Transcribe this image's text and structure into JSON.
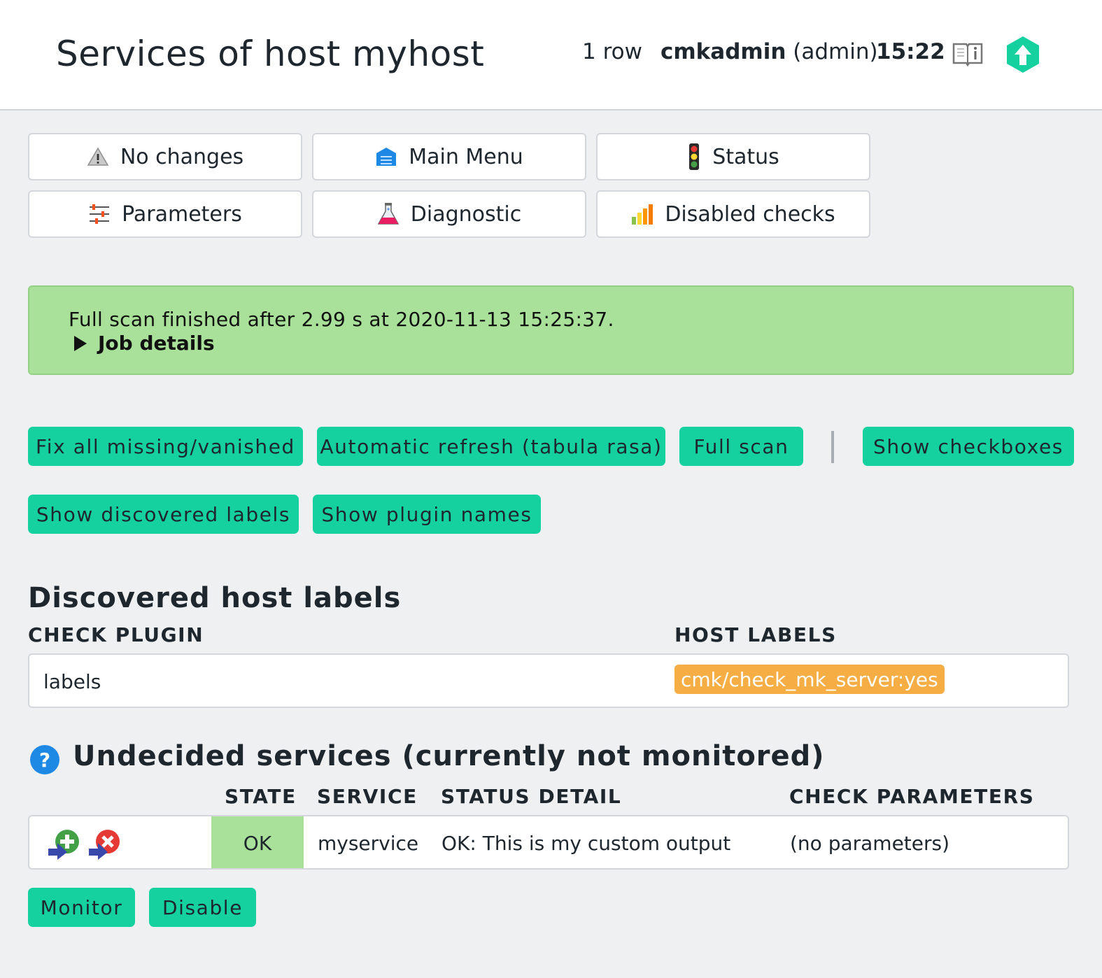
{
  "header": {
    "title": "Services of host myhost",
    "row_count": "1 row",
    "user_name": "cmkadmin",
    "user_role": "(admin)",
    "time": "15:22",
    "help_icon": "book-icon",
    "logo_icon": "checkmk-logo-icon"
  },
  "page_menu": [
    {
      "label": "No changes",
      "icon": "warning-icon"
    },
    {
      "label": "Main Menu",
      "icon": "main-menu-icon"
    },
    {
      "label": "Status",
      "icon": "traffic-light-icon"
    },
    {
      "label": "Parameters",
      "icon": "parameters-icon"
    },
    {
      "label": "Diagnostic",
      "icon": "flask-icon"
    },
    {
      "label": "Disabled checks",
      "icon": "bar-chart-icon"
    }
  ],
  "message": {
    "text": "Full scan finished after 2.99 s at 2020-11-13 15:25:37.",
    "job_details": "Job details",
    "background_color": "#a9e19a"
  },
  "actions": {
    "fix_all": "Fix all missing/vanished",
    "auto_refresh": "Automatic refresh (tabula rasa)",
    "full_scan": "Full scan",
    "show_checkboxes": "Show checkboxes",
    "show_labels": "Show discovered labels",
    "show_plugins": "Show plugin names",
    "button_color": "#15d1a0"
  },
  "host_labels": {
    "title": "Discovered host labels",
    "col_plugin": "CHECK PLUGIN",
    "col_labels": "HOST LABELS",
    "rows": [
      {
        "plugin": "labels",
        "label": "cmk/check_mk_server:yes"
      }
    ],
    "label_color": "#f5ad44"
  },
  "undecided": {
    "title": "Undecided services (currently not monitored)",
    "icon": "help-icon",
    "col_state": "STATE",
    "col_service": "SERVICE",
    "col_detail": "STATUS DETAIL",
    "col_params": "CHECK PARAMETERS",
    "rows": [
      {
        "state": "OK",
        "service": "myservice",
        "detail": "OK: This is my custom output",
        "params": "(no parameters)"
      }
    ],
    "monitor_label": "Monitor",
    "disable_label": "Disable",
    "state_ok_color": "#a9e19a"
  }
}
